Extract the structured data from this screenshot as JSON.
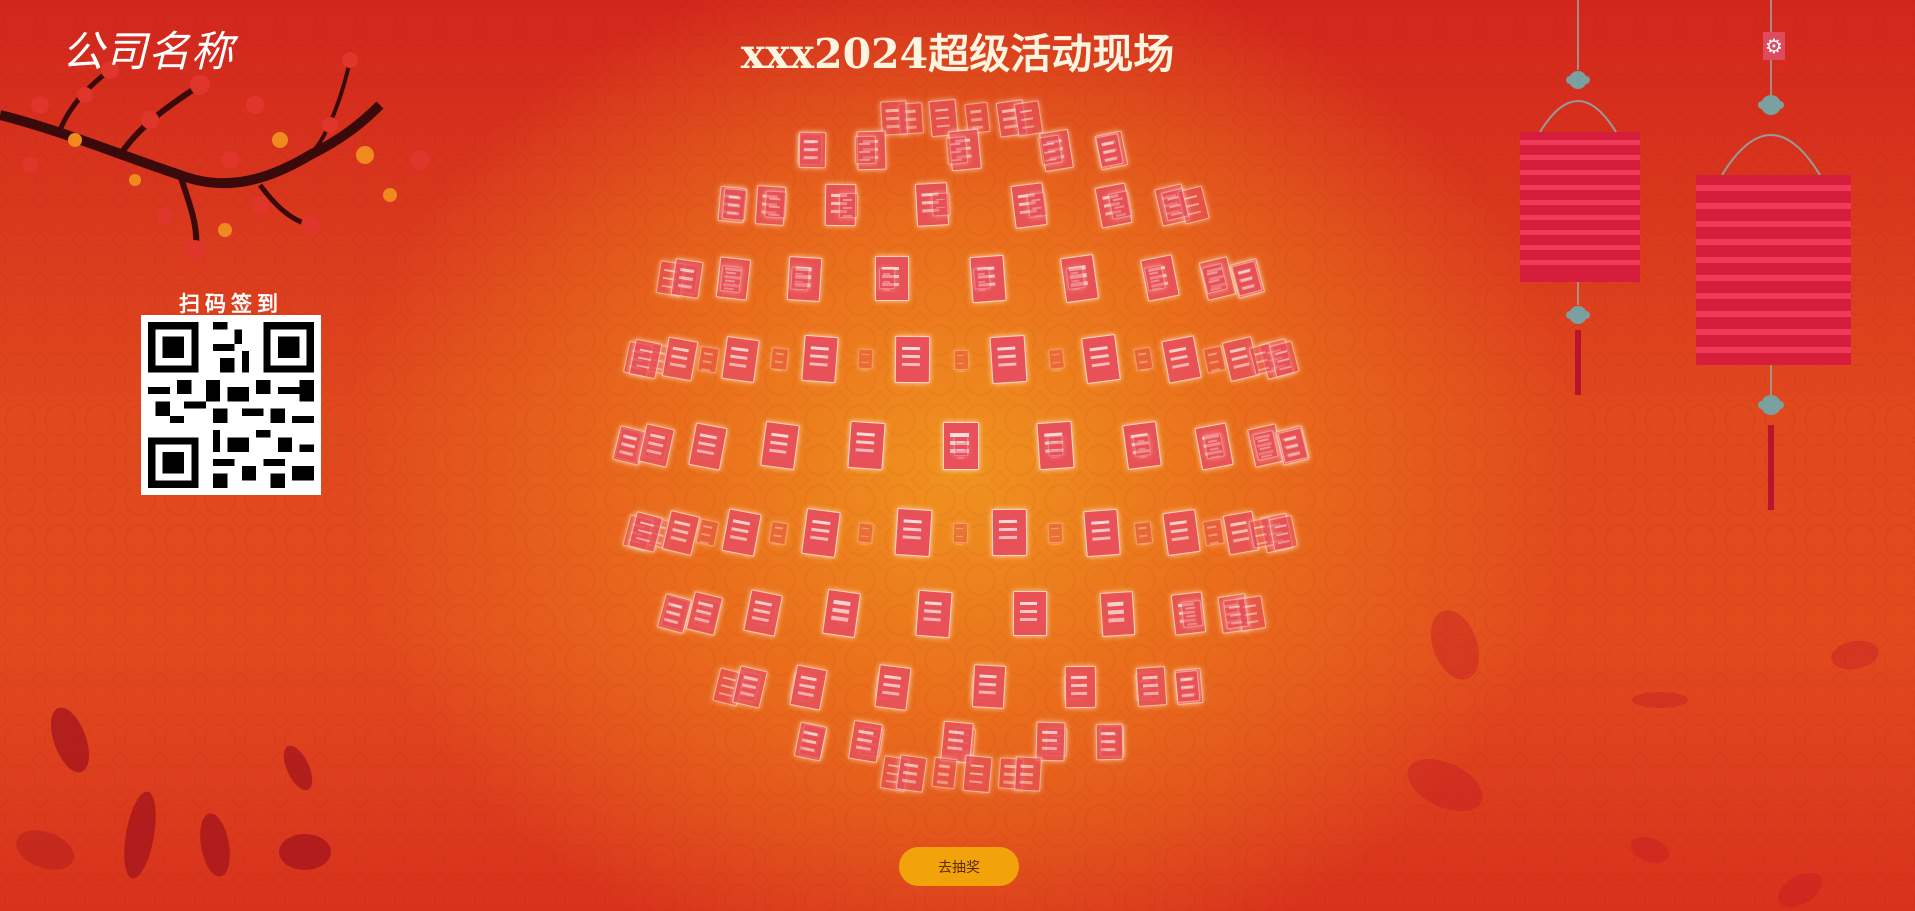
{
  "header": {
    "company_name": "公司名称",
    "title": "xxx2024超级活动现场"
  },
  "checkin": {
    "label": "扫码签到"
  },
  "settings": {
    "icon": "gear-icon"
  },
  "actions": {
    "lottery_button": "去抽奖"
  },
  "theme": {
    "background_primary": "#d2261d",
    "background_glow": "#f0931f",
    "card_color": "#e8505b",
    "button_color": "#f2a30c",
    "lantern_color": "#d61e3c"
  }
}
